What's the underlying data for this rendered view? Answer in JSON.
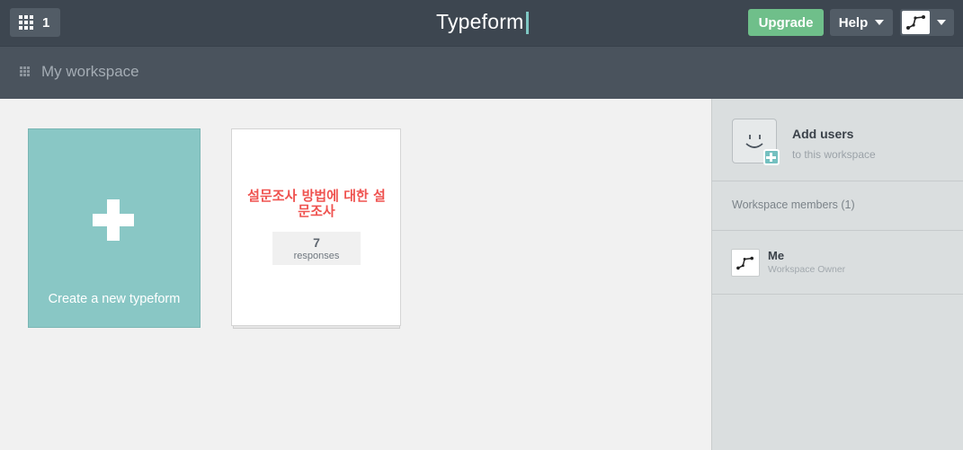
{
  "topbar": {
    "workspace_count": "1",
    "brand": "Typeform",
    "upgrade_label": "Upgrade",
    "help_label": "Help"
  },
  "subbar": {
    "workspace_title": "My workspace"
  },
  "main": {
    "create_label": "Create a new typeform",
    "forms": [
      {
        "title": "설문조사 방법에 대한 설문조사",
        "responses_count": "7",
        "responses_label": "responses"
      }
    ]
  },
  "sidebar": {
    "add_users_title": "Add users",
    "add_users_sub": "to this workspace",
    "members_label": "Workspace members (1)",
    "members": [
      {
        "name": "Me",
        "role": "Workspace Owner"
      }
    ]
  },
  "colors": {
    "topbar": "#3d4650",
    "subbar": "#4a535d",
    "upgrade": "#6fbf8a",
    "create_card": "#89c7c5",
    "form_title": "#ef5350",
    "sidebar": "#dadedf"
  },
  "icons": [
    "apps-grid-icon",
    "workspace-grid-icon",
    "chevron-down-icon",
    "user-avatar-icon",
    "smiley-icon",
    "plus-icon"
  ]
}
